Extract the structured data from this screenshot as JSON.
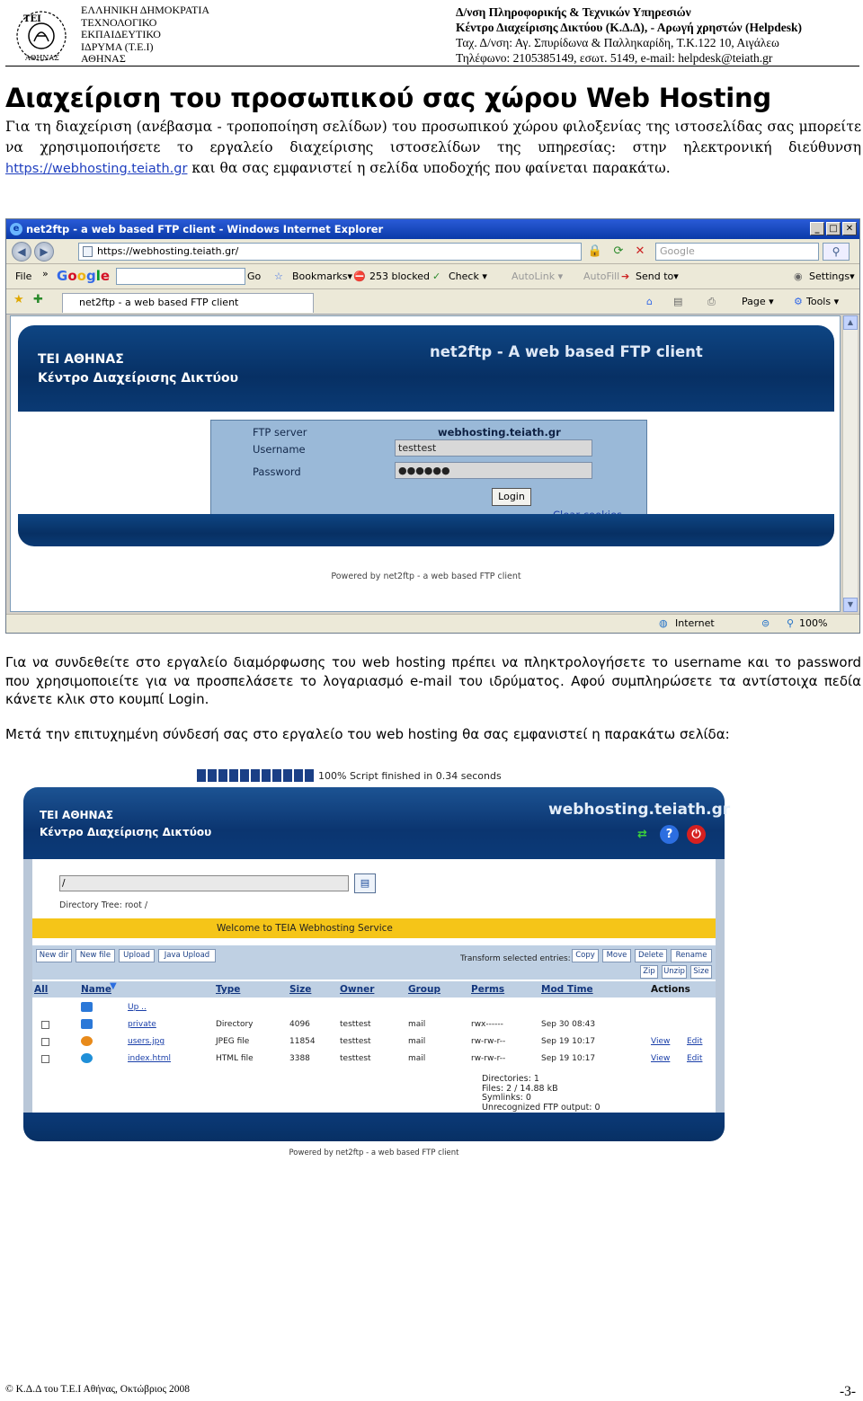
{
  "header": {
    "left_lines": [
      "ΕΛΛΗΝΙΚΗ ΔΗΜΟΚΡΑΤΙΑ",
      "ΤΕΧΝΟΛΟΓΙΚΟ",
      "ΕΚΠΑΙΔΕΥΤΙΚΟ",
      "ΙΔΡΥΜΑ (Τ.Ε.Ι)",
      "ΑΘΗΝΑΣ"
    ],
    "right_line1": "Δ/νση Πληροφορικής & Τεχνικών Υπηρεσιών",
    "right_line2": "Κέντρο Διαχείρισης Δικτύου (Κ.Δ.Δ), - Αρωγή χρηστών (Helpdesk)",
    "right_line3": "Ταχ. Δ/νση: Αγ. Σπυρίδωνα & Παλληκαρίδη, Τ.Κ.122 10, Αιγάλεω",
    "right_line4": "Τηλέφωνο: 2105385149, εσωτ. 5149, e-mail: helpdesk@teiath.gr",
    "logo_text": "ΤΕΙ ΑΘΗΝΑΣ"
  },
  "title": "Διαχείριση του προσωπικού σας χώρου Web Hosting",
  "intro": {
    "text_before_link": "Για τη διαχείριση (ανέβασμα - τροποποίηση σελίδων) του προσωπικού χώρου φιλοξενίας της ιστοσελίδας σας μπορείτε να χρησιμοποιήσετε το εργαλείο διαχείρισης ιστοσελίδων της υπηρεσίας: στην ηλεκτρονική διεύθυνση ",
    "link": "https://webhosting.teiath.gr",
    "text_after_link": " και θα σας εμφανιστεί η σελίδα υποδοχής που φαίνεται παρακάτω."
  },
  "browser": {
    "window_title": "net2ftp - a web based FTP client - Windows Internet Explorer",
    "url": "https://webhosting.teiath.gr/",
    "search_placeholder": "Google",
    "toolbar": {
      "file": "File",
      "go": "Go",
      "bookmarks": "Bookmarks▾",
      "blocked": "253 blocked",
      "check": "Check ▾",
      "autolink": "AutoLink ▾",
      "autofill": "AutoFill",
      "sendto": "Send to▾",
      "settings": "Settings▾"
    },
    "tab_label": "net2ftp - a web based FTP client",
    "page_menu": "Page ▾",
    "tools_menu": "Tools ▾",
    "status_zone": "Internet",
    "zoom": "100%",
    "page": {
      "brand_line1": "ΤΕΙ ΑΘΗΝΑΣ",
      "brand_line2": "Κέντρο Διαχείρισης Δικτύου",
      "app_name": "net2ftp - A web based FTP client",
      "ftp_server_label": "FTP server",
      "ftp_server_value": "webhosting.teiath.gr",
      "username_label": "Username",
      "username_value": "testtest",
      "password_label": "Password",
      "password_value": "●●●●●●",
      "login_button": "Login",
      "clear_cookies": "Clear cookies",
      "powered": "Powered by net2ftp - a web based FTP client"
    }
  },
  "paragraph1": "Για να συνδεθείτε στο εργαλείο διαμόρφωσης του web hosting πρέπει να πληκτρολογήσετε το username και το password που χρησιμοποιείτε για να προσπελάσετε το λογαριασμό e-mail του ιδρύματος. Αφού συμπληρώσετε τα αντίστοιχα πεδία κάνετε κλικ στο κουμπί Login.",
  "paragraph2": "Μετά την επιτυχημένη σύνδεσή σας στο εργαλείο του web hosting θα σας εμφανιστεί η παρακάτω σελίδα:",
  "filemanager": {
    "progress_text": "100% Script finished in 0.34 seconds",
    "progress_fraction": 1.0,
    "brand_line1": "ΤΕΙ ΑΘΗΝΑΣ",
    "brand_line2": "Κέντρο Διαχείρισης Δικτύου",
    "site": "webhosting.teiath.gr",
    "directory_value": "/",
    "directory_tree": "Directory Tree: root /",
    "welcome": "Welcome to TEIA Webhosting Service",
    "buttons_left": [
      "New dir",
      "New file",
      "Upload",
      "Java Upload"
    ],
    "transform_label": "Transform selected entries:",
    "buttons_right_row1": [
      "Copy",
      "Move",
      "Delete",
      "Rename"
    ],
    "buttons_right_row2": [
      "Zip",
      "Unzip",
      "Size"
    ],
    "columns": {
      "all": "All",
      "name": "Name",
      "type": "Type",
      "size": "Size",
      "owner": "Owner",
      "group": "Group",
      "perms": "Perms",
      "mod_time": "Mod Time",
      "actions": "Actions"
    },
    "up_link": "Up ..",
    "rows": [
      {
        "name": "private",
        "type": "Directory",
        "size": "4096",
        "owner": "testtest",
        "group": "mail",
        "perms": "rwx------",
        "mod": "Sep 30 08:43",
        "view": "",
        "edit": ""
      },
      {
        "name": "users.jpg",
        "type": "JPEG file",
        "size": "11854",
        "owner": "testtest",
        "group": "mail",
        "perms": "rw-rw-r--",
        "mod": "Sep 19 10:17",
        "view": "View",
        "edit": "Edit"
      },
      {
        "name": "index.html",
        "type": "HTML file",
        "size": "3388",
        "owner": "testtest",
        "group": "mail",
        "perms": "rw-rw-r--",
        "mod": "Sep 19 10:17",
        "view": "View",
        "edit": "Edit"
      }
    ],
    "summary": [
      "Directories: 1",
      "Files: 2 / 14.88 kB",
      "Symlinks: 0",
      "Unrecognized FTP output: 0"
    ],
    "powered": "Powered by net2ftp - a web based FTP client"
  },
  "footer": {
    "left": "© Κ.Δ.Δ του Τ.Ε.Ι Αθήνας, Οκτώβριος 2008",
    "page_number": "-3-"
  }
}
